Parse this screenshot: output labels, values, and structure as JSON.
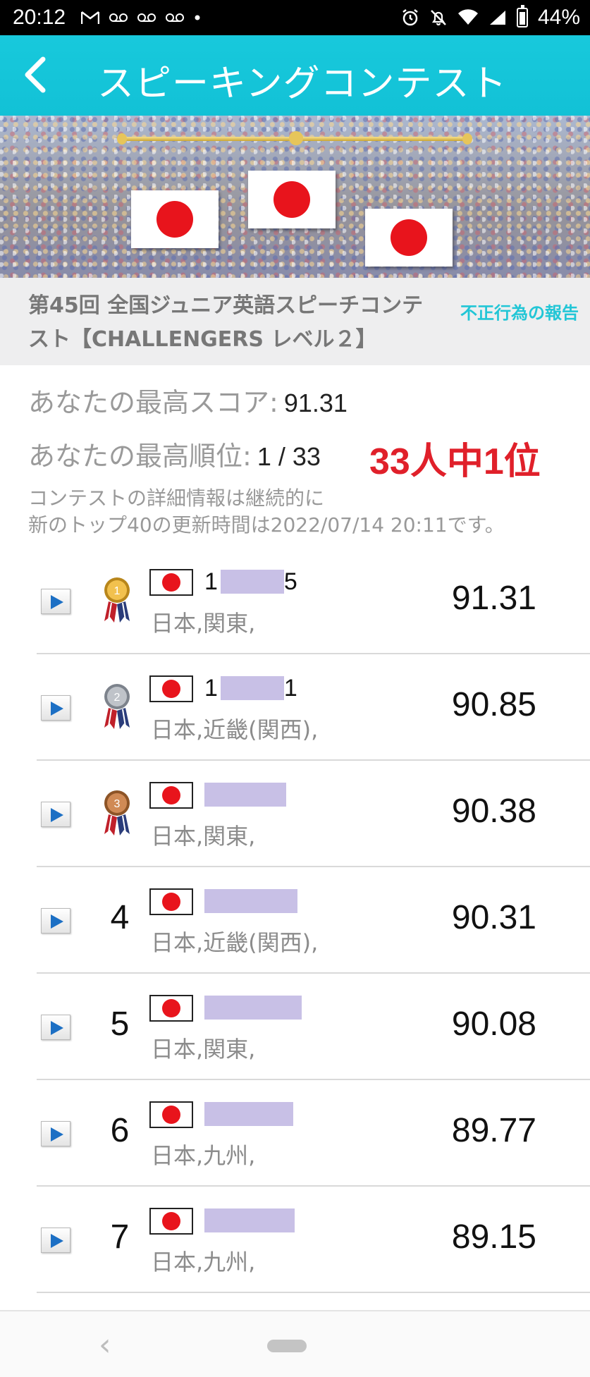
{
  "status_bar": {
    "time": "20:12",
    "battery": "44%",
    "left_icons": [
      "gmail-icon",
      "voicemail-icon",
      "voicemail-icon",
      "voicemail-icon",
      "dot-icon"
    ],
    "right_icons": [
      "alarm-icon",
      "mute-icon",
      "wifi-icon",
      "signal-icon",
      "battery-icon"
    ]
  },
  "app_bar": {
    "title": "スピーキングコンテスト",
    "color": "#14c4d8"
  },
  "contest": {
    "title": "第45回 全国ジュニア英語スピーチコンテスト【CHALLENGERS レベル２】",
    "report_link": "不正行為の報告"
  },
  "summary": {
    "best_score_label": "あなたの最高スコア:",
    "best_score": "91.31",
    "best_rank_label": "あなたの最高順位:",
    "best_rank": "1 / 33",
    "rank_callout": "33人中1位",
    "note_line1": "コンテストの詳細情報は継続的に",
    "note_line2": "新のトップ40の更新時間は2022/07/14 20:11です。"
  },
  "leaderboard": [
    {
      "rank": "1",
      "medal": "gold",
      "name_prefix": "1",
      "name_suffix": "5",
      "region": "日本,関東,",
      "score": "91.31"
    },
    {
      "rank": "2",
      "medal": "silver",
      "name_prefix": "1",
      "name_suffix": "1",
      "region": "日本,近畿(関西),",
      "score": "90.85"
    },
    {
      "rank": "3",
      "medal": "bronze",
      "name_prefix": "",
      "name_suffix": "",
      "region": "日本,関東,",
      "score": "90.38"
    },
    {
      "rank": "4",
      "medal": "",
      "name_prefix": "",
      "name_suffix": "",
      "region": "日本,近畿(関西),",
      "score": "90.31"
    },
    {
      "rank": "5",
      "medal": "",
      "name_prefix": "",
      "name_suffix": "",
      "region": "日本,関東,",
      "score": "90.08"
    },
    {
      "rank": "6",
      "medal": "",
      "name_prefix": "",
      "name_suffix": "",
      "region": "日本,九州,",
      "score": "89.77"
    },
    {
      "rank": "7",
      "medal": "",
      "name_prefix": "",
      "name_suffix": "",
      "region": "日本,九州,",
      "score": "89.15"
    }
  ],
  "nav_bar": {
    "back_glyph": "‹"
  }
}
